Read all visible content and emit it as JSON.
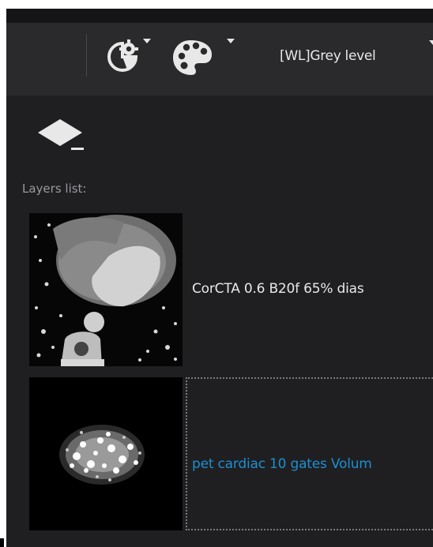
{
  "toolbar": {
    "colormap_settings_icon": "colormap-settings-icon",
    "palette_icon": "palette-icon",
    "window_level_label": "[WL]Grey level"
  },
  "layers": {
    "title": "Layers list:",
    "items": [
      {
        "name": "CorCTA  0.6  B20f  65% dias",
        "thumbnail": "cardiac-ct-axial-slice",
        "selected": false,
        "color": "#e8e8e8"
      },
      {
        "name": "pet cardiac 10 gates Volum",
        "thumbnail": "cardiac-pet-slice",
        "selected": true,
        "color": "#1f8fd0"
      }
    ]
  }
}
